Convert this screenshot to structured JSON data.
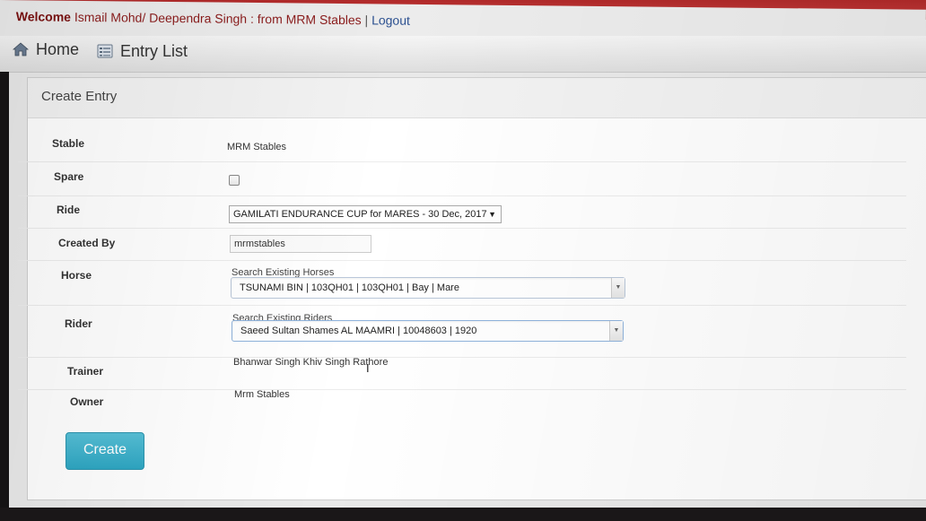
{
  "header": {
    "welcome_label": "Welcome",
    "user_text": "Ismail Mohd/ Deependra Singh : from MRM Stables",
    "separator": "|",
    "logout_label": "Logout"
  },
  "nav": {
    "home_label": "Home",
    "entry_list_label": "Entry List"
  },
  "panel": {
    "title": "Create Entry"
  },
  "form": {
    "stable": {
      "label": "Stable",
      "value": "MRM Stables"
    },
    "spare": {
      "label": "Spare",
      "checked": false
    },
    "ride": {
      "label": "Ride",
      "selected": "GAMILATI ENDURANCE CUP for MARES - 30 Dec, 2017"
    },
    "created_by": {
      "label": "Created By",
      "value": "mrmstables"
    },
    "horse": {
      "label": "Horse",
      "search_label": "Search Existing Horses",
      "selected": "TSUNAMI BIN | 103QH01 | 103QH01 | Bay | Mare"
    },
    "rider": {
      "label": "Rider",
      "search_label": "Search Existing Riders",
      "selected": "Saeed Sultan Shames AL MAAMRI | 10048603 | 1920"
    },
    "trainer": {
      "label": "Trainer",
      "value": "Bhanwar Singh Khiv Singh Rathore"
    },
    "owner": {
      "label": "Owner",
      "value": "Mrm Stables"
    }
  },
  "actions": {
    "create_label": "Create"
  },
  "icons": {
    "home": "home-icon",
    "entry_list": "list-icon",
    "dropdown": "chevron-down-icon",
    "cursor": "text-cursor-icon"
  },
  "colors": {
    "header_red": "#b12a2a",
    "welcome_text": "#8b1c1c",
    "link_blue": "#2a4f8f",
    "create_button": "#3fb2cc"
  }
}
